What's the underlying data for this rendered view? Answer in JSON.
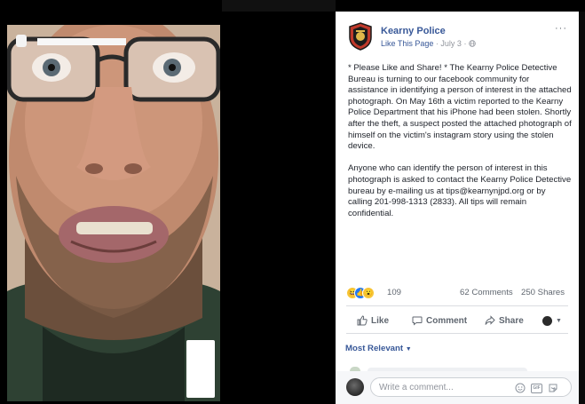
{
  "post": {
    "page_name": "Kearny Police",
    "like_page": "Like This Page",
    "separator": "·",
    "date": "July 3",
    "audience_icon": "globe-icon",
    "more_label": "···",
    "body": [
      "* Please Like and Share! * The Kearny Police Detective Bureau is turning to our facebook community for assistance in identifying a person of interest in the attached photograph. On May 16th a victim reported to the Kearny Police Department that his iPhone had been stolen. Shortly after the theft, a suspect posted the attached photograph of himself on the victim's instagram story using the stolen device.",
      "Anyone who can identify the person of interest in this photograph is asked to contact the Kearny Police Detective bureau by e-mailing us at tips@kearnynjpd.org or by calling 201-998-1313 (2833). All tips will remain confidential."
    ]
  },
  "stats": {
    "reaction_icons": [
      "haha-icon",
      "like-icon",
      "wow-icon"
    ],
    "reaction_count": "109",
    "comments": "62 Comments",
    "shares": "250 Shares"
  },
  "actions": {
    "like": "Like",
    "comment": "Comment",
    "share": "Share"
  },
  "comments_section": {
    "sort_label": "Most Relevant",
    "input_placeholder": "Write a comment..."
  },
  "colors": {
    "link": "#385898",
    "muted": "#606770",
    "text": "#1d2129",
    "background": "#000000"
  }
}
